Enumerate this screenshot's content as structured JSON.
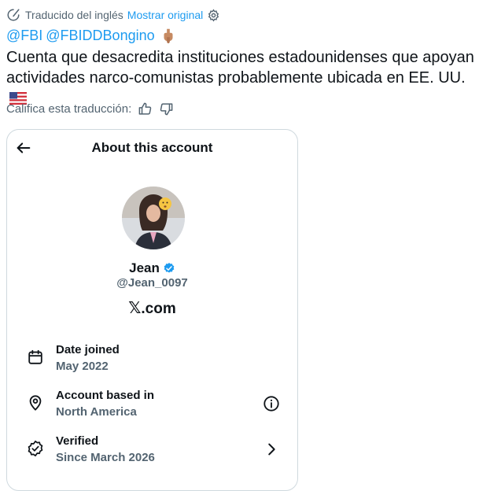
{
  "translation": {
    "label": "Traducido del inglés",
    "show_original": "Mostrar original"
  },
  "mentions": [
    "@FBI",
    "@FBIDDBongino"
  ],
  "body_text": "Cuenta que desacredita instituciones estadounidenses que apoyan actividades narco-comunistas probablemente ubicada en EE. UU.",
  "rate_label": "Califica esta traducción:",
  "card": {
    "title": "About this account",
    "name": "Jean",
    "handle": "@Jean_0097",
    "site": ".com",
    "site_glyph": "𝕏",
    "rows": [
      {
        "title": "Date joined",
        "value": "May 2022",
        "icon": "calendar-icon"
      },
      {
        "title": "Account based in",
        "value": "North America",
        "icon": "location-pin-icon",
        "action": "info-icon"
      },
      {
        "title": "Verified",
        "value": "Since March 2026",
        "icon": "verified-badge-outline-icon",
        "action": "chevron-right-icon"
      }
    ]
  },
  "colors": {
    "link": "#1d9bf0",
    "muted": "#536471",
    "text": "#0f1419",
    "verified": "#1d9bf0",
    "border": "#cfd9de"
  }
}
